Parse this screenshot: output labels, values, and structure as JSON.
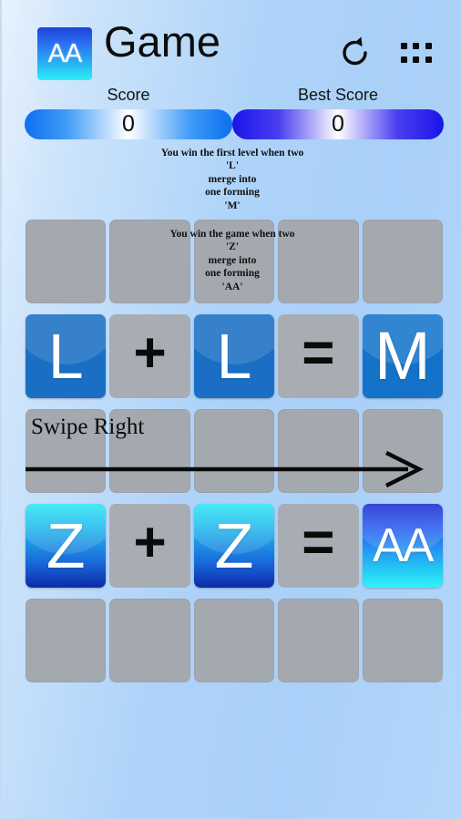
{
  "app": {
    "title": "Game",
    "logo_text": "AA",
    "logo_icon": "aa-logo-icon",
    "reset_icon": "rotate-ccw-icon",
    "menu_icon": "grid-dots-menu-icon",
    "background_color": "#aed3f9"
  },
  "scores": {
    "current": {
      "label": "Score",
      "value": "0",
      "accent": "#0b6ff0"
    },
    "best": {
      "label": "Best Score",
      "value": "0",
      "accent": "#1b14e8"
    }
  },
  "instructions": {
    "level": [
      "You win the first level when two",
      "'L'",
      "merge into",
      "one forming",
      "'M'"
    ],
    "game": [
      "You win the game when two",
      "'Z'",
      "merge into",
      "one forming",
      "'AA'"
    ]
  },
  "swipe": {
    "label": "Swipe Right",
    "arrow_icon": "arrow-right-icon"
  },
  "board": {
    "columns": 5,
    "rows": [
      {
        "name": "instruction-row",
        "cells": [
          {
            "kind": "empty",
            "text": ""
          },
          {
            "kind": "empty",
            "text": ""
          },
          {
            "kind": "empty",
            "text": ""
          },
          {
            "kind": "empty",
            "text": ""
          },
          {
            "kind": "empty",
            "text": ""
          }
        ]
      },
      {
        "name": "level-formula-row",
        "cells": [
          {
            "kind": "letter",
            "level": "L",
            "text": "L",
            "color": "#1a6fc4"
          },
          {
            "kind": "op",
            "text": "+"
          },
          {
            "kind": "letter",
            "level": "L",
            "text": "L",
            "color": "#1a6fc4"
          },
          {
            "kind": "op",
            "text": "="
          },
          {
            "kind": "letter",
            "level": "M",
            "text": "M",
            "color": "#1473c9"
          }
        ]
      },
      {
        "name": "swipe-row",
        "cells": [
          {
            "kind": "empty",
            "text": ""
          },
          {
            "kind": "empty",
            "text": ""
          },
          {
            "kind": "empty",
            "text": ""
          },
          {
            "kind": "empty",
            "text": ""
          },
          {
            "kind": "empty",
            "text": ""
          }
        ]
      },
      {
        "name": "game-formula-row",
        "cells": [
          {
            "kind": "letter",
            "level": "Z",
            "text": "Z",
            "color": "#23bdef"
          },
          {
            "kind": "op",
            "text": "+"
          },
          {
            "kind": "letter",
            "level": "Z",
            "text": "Z",
            "color": "#23bdef"
          },
          {
            "kind": "op",
            "text": "="
          },
          {
            "kind": "letter",
            "level": "AA",
            "text": "AA",
            "color": "#23c4f4"
          }
        ]
      },
      {
        "name": "empty-row",
        "cells": [
          {
            "kind": "empty",
            "text": ""
          },
          {
            "kind": "empty",
            "text": ""
          },
          {
            "kind": "empty",
            "text": ""
          },
          {
            "kind": "empty",
            "text": ""
          },
          {
            "kind": "empty",
            "text": ""
          }
        ]
      }
    ]
  }
}
